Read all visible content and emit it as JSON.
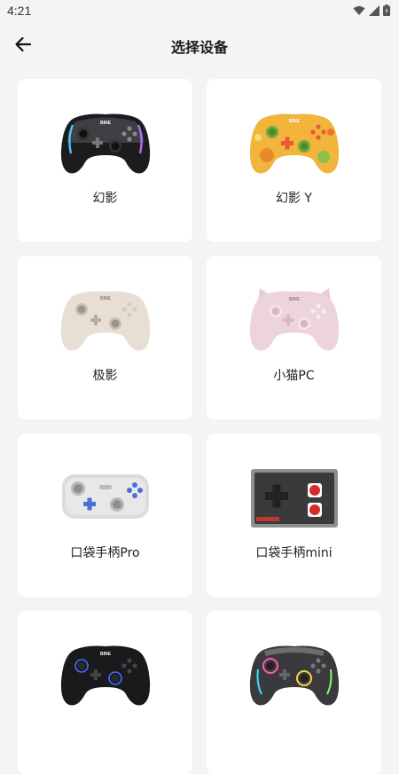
{
  "status_bar": {
    "time": "4:21",
    "icons": [
      "wifi-icon",
      "signal-icon",
      "battery-icon"
    ]
  },
  "header": {
    "back_icon": "arrow-left-icon",
    "title": "选择设备"
  },
  "devices": [
    {
      "name": "幻影",
      "image": "controller-black-rgb"
    },
    {
      "name": "幻影 Y",
      "image": "controller-orange-pattern"
    },
    {
      "name": "极影",
      "image": "controller-beige"
    },
    {
      "name": "小猫PC",
      "image": "controller-pink-cat"
    },
    {
      "name": "口袋手柄Pro",
      "image": "controller-pocket-grey"
    },
    {
      "name": "口袋手柄mini",
      "image": "controller-retro-nes"
    },
    {
      "name": "",
      "image": "controller-black-blue"
    },
    {
      "name": "",
      "image": "controller-transparent-rgb"
    }
  ],
  "colors": {
    "background": "#f4f4f4",
    "card": "#ffffff"
  }
}
